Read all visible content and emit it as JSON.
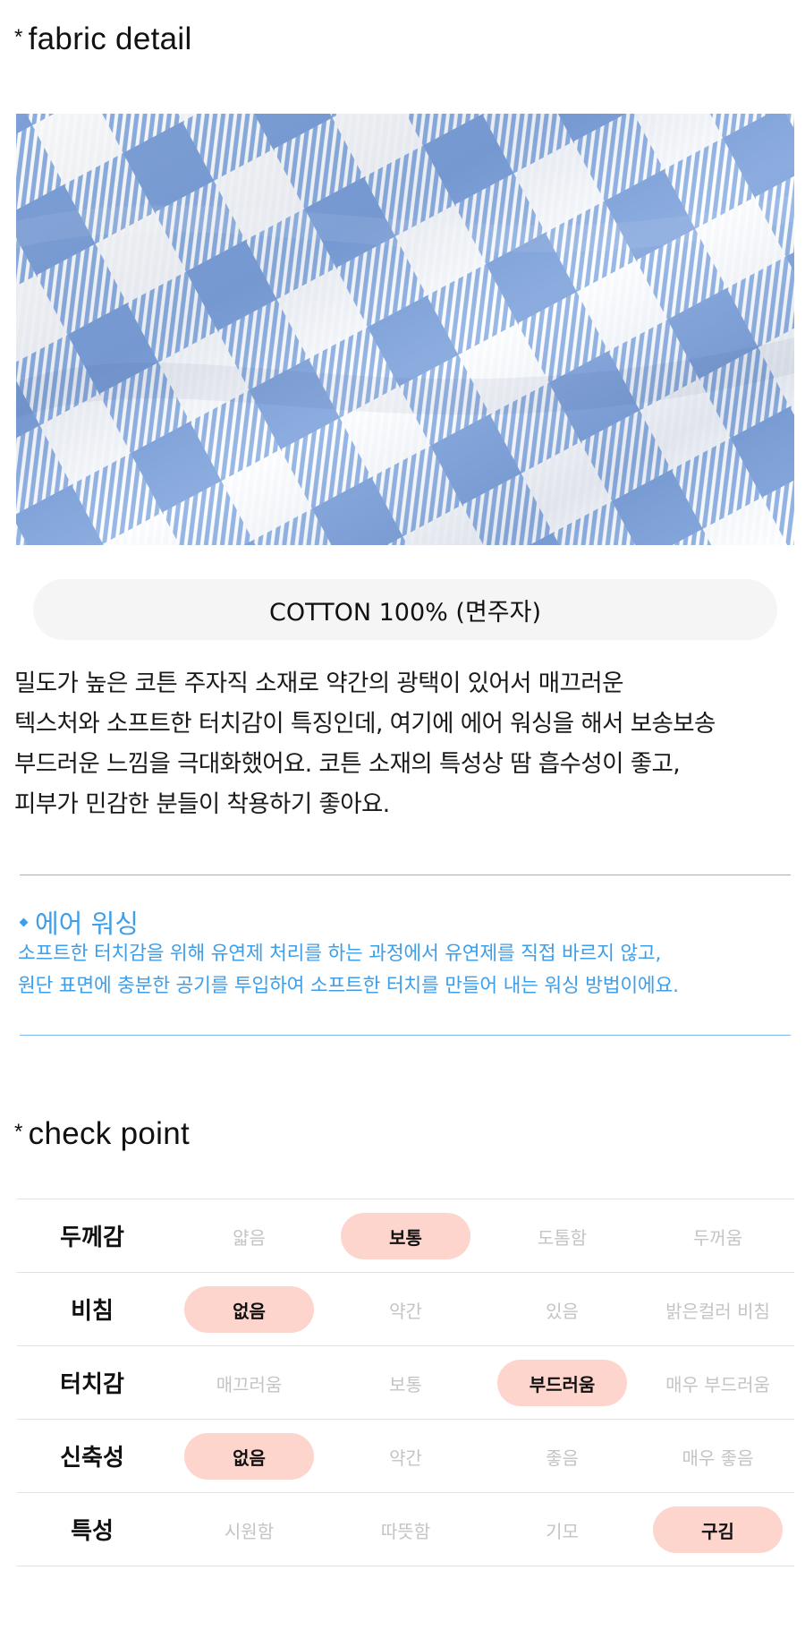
{
  "fabric_section": {
    "star": "*",
    "heading": "fabric detail",
    "composition": "COTTON 100% (면주자)",
    "description_lines": [
      "밀도가 높은 코튼 주자직 소재로 약간의 광택이 있어서 매끄러운",
      "텍스처와 소프트한 터치감이 특징인데, 여기에 에어 워싱을 해서 보송보송",
      "부드러운 느낌을 극대화했어요. 코튼 소재의 특성상 땀 흡수성이 좋고,",
      "피부가 민감한 분들이 착용하기 좋아요."
    ]
  },
  "air_washing": {
    "title": "에어 워싱",
    "lines": [
      "소프트한 터치감을 위해 유연제 처리를 하는 과정에서 유연제를 직접 바르지 않고,",
      "원단 표면에 충분한 공기를 투입하여 소프트한 터치를 만들어 내는 워싱 방법이에요."
    ]
  },
  "check_section": {
    "star": "*",
    "heading": "check point",
    "rows": [
      {
        "label": "두께감",
        "options": [
          "얇음",
          "보통",
          "도톰함",
          "두꺼움"
        ],
        "selected": "보통"
      },
      {
        "label": "비침",
        "options": [
          "없음",
          "약간",
          "있음",
          "밝은컬러 비침"
        ],
        "selected": "없음"
      },
      {
        "label": "터치감",
        "options": [
          "매끄러움",
          "보통",
          "부드러움",
          "매우 부드러움"
        ],
        "selected": "부드러움"
      },
      {
        "label": "신축성",
        "options": [
          "없음",
          "약간",
          "좋음",
          "매우 좋음"
        ],
        "selected": "없음"
      },
      {
        "label": "특성",
        "options": [
          "시원함",
          "따뜻함",
          "기모",
          "구김"
        ],
        "selected": "구김"
      }
    ]
  },
  "colors": {
    "accent_blue": "#3f9ee8",
    "divider_blue": "#7eb6ec",
    "selected_pill": "#fdd5cc",
    "unselected_text": "#c4c4c4",
    "fabric_blue": "#8fb2e4",
    "pill_bg": "#f5f5f5"
  },
  "icons": {
    "air_bullet": "diamond-bullet-icon"
  }
}
